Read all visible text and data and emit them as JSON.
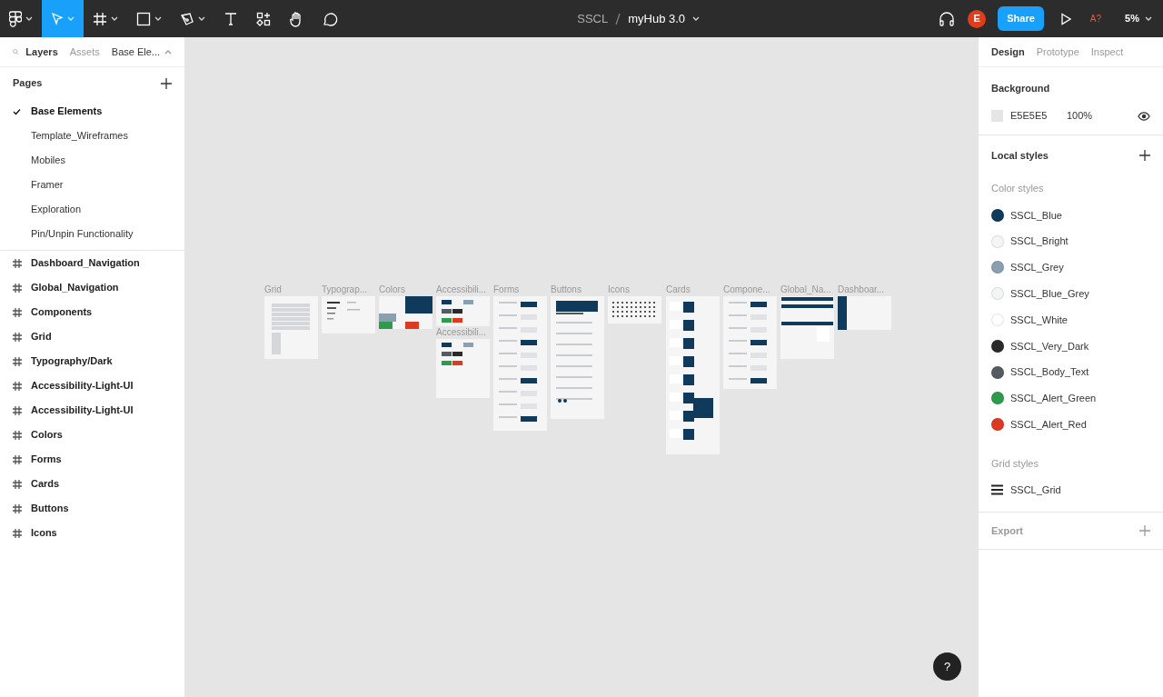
{
  "toolbar": {
    "file_project": "SSCL",
    "file_name": "myHub 3.0",
    "avatar": "E",
    "share": "Share",
    "zoom": "5%",
    "font_warning": "A?"
  },
  "left_panel": {
    "tabs": [
      {
        "label": "Layers",
        "selected": true
      },
      {
        "label": "Assets",
        "selected": false
      }
    ],
    "page_picker": "Base Ele...",
    "pages_title": "Pages",
    "pages": [
      {
        "label": "Base Elements",
        "selected": true
      },
      {
        "label": "Template_Wireframes",
        "selected": false
      },
      {
        "label": "Mobiles",
        "selected": false
      },
      {
        "label": "Framer",
        "selected": false
      },
      {
        "label": "Exploration",
        "selected": false
      },
      {
        "label": "Pin/Unpin Functionality",
        "selected": false
      }
    ],
    "layers": [
      "Dashboard_Navigation",
      "Global_Navigation",
      "Components",
      "Grid",
      "Typography/Dark",
      "Accessibility-Light-UI",
      "Accessibility-Light-UI",
      "Colors",
      "Forms",
      "Cards",
      "Buttons",
      "Icons"
    ]
  },
  "canvas": {
    "frames": [
      {
        "title": "Grid"
      },
      {
        "title": "Typograp..."
      },
      {
        "title": "Colors"
      },
      {
        "title": "Accessibili..."
      },
      {
        "title": "Accessibili..."
      },
      {
        "title": "Forms"
      },
      {
        "title": "Buttons"
      },
      {
        "title": "Icons"
      },
      {
        "title": "Cards"
      },
      {
        "title": "Compone..."
      },
      {
        "title": "Global_Na..."
      },
      {
        "title": "Dashboar..."
      }
    ]
  },
  "right_panel": {
    "tabs": [
      {
        "label": "Design",
        "selected": true
      },
      {
        "label": "Prototype",
        "selected": false
      },
      {
        "label": "Inspect",
        "selected": false
      }
    ],
    "background": {
      "title": "Background",
      "hex": "E5E5E5",
      "opacity": "100%",
      "color": "#e5e5e5"
    },
    "local_styles": "Local styles",
    "color_styles_title": "Color styles",
    "color_styles": [
      {
        "name": "SSCL_Blue",
        "color": "#0f3a5c"
      },
      {
        "name": "SSCL_Bright",
        "color": "#f5f5f5"
      },
      {
        "name": "SSCL_Grey",
        "color": "#8a9fb0"
      },
      {
        "name": "SSCL_Blue_Grey",
        "color": "#f3f4f5"
      },
      {
        "name": "SSCL_White",
        "color": "#ffffff"
      },
      {
        "name": "SSCL_Very_Dark",
        "color": "#2a2a2a"
      },
      {
        "name": "SSCL_Body_Text",
        "color": "#545b62"
      },
      {
        "name": "SSCL_Alert_Green",
        "color": "#2e9a4e"
      },
      {
        "name": "SSCL_Alert_Red",
        "color": "#dc3b22"
      }
    ],
    "grid_styles_title": "Grid styles",
    "grid_styles": [
      "SSCL_Grid"
    ],
    "export": "Export"
  },
  "help": "?"
}
